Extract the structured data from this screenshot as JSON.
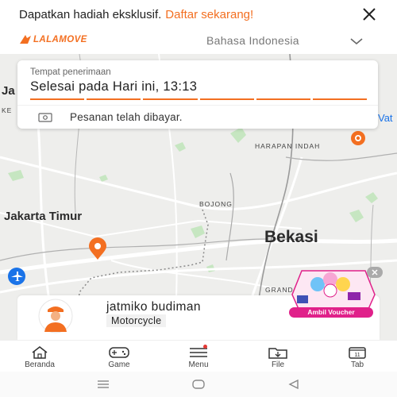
{
  "promo": {
    "text": "Dapatkan hadiah eksklusif.",
    "link": "Daftar sekarang!"
  },
  "header": {
    "brand": "LALAMOVE",
    "language": "Bahasa Indonesia"
  },
  "map": {
    "labels": {
      "jakarta_timur": "Jakarta Timur",
      "bekasi": "Bekasi",
      "harapan_indah": "HARAPAN INDAH",
      "bojong": "BOJONG",
      "grand": "GRAND",
      "left_edge_ja": "Ja",
      "left_edge_ke": "KE",
      "right_edge": "Vat"
    }
  },
  "order_card": {
    "label": "Tempat penerimaan",
    "value": "Selesai pada Hari ini, 13:13",
    "payment_status": "Pesanan telah dibayar."
  },
  "driver": {
    "name": "jatmiko budiman",
    "vehicle": "Motorcycle"
  },
  "voucher": {
    "label": "Ambil Voucher"
  },
  "nav": [
    {
      "label": "Beranda",
      "icon": "home-icon"
    },
    {
      "label": "Game",
      "icon": "gamepad-icon"
    },
    {
      "label": "Menu",
      "icon": "menu-icon"
    },
    {
      "label": "File",
      "icon": "file-icon"
    },
    {
      "label": "Tab",
      "icon": "tabs-icon"
    }
  ],
  "colors": {
    "accent": "#f36f21",
    "map_bg": "#eeeeec",
    "voucher_pink": "#e0218a"
  }
}
